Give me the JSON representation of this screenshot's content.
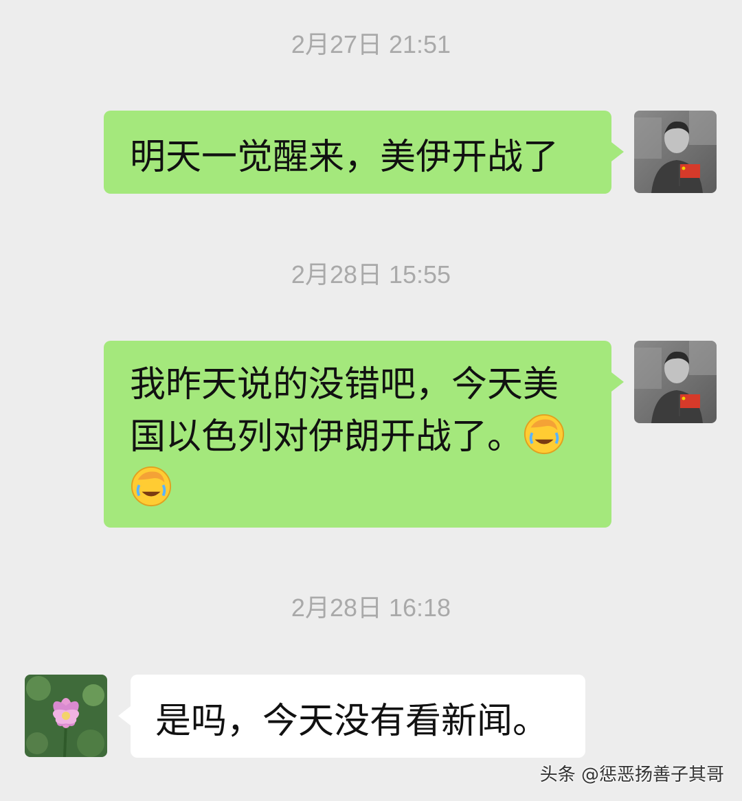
{
  "messages": [
    {
      "timestamp": "2月27日 21:51",
      "text": "明天一觉醒来，美伊开战了"
    },
    {
      "timestamp": "2月28日 15:55",
      "line1": "我昨天说的没错吧，今天美",
      "line2": "国以色列对伊朗开战了。",
      "emoji": "face-palm-crying-laughing-emoji"
    },
    {
      "timestamp": "2月28日 16:18",
      "text": "是吗，今天没有看新闻。"
    }
  ],
  "avatars": {
    "self": "grayscale-man-photo-with-red-flag-avatar",
    "other": "pink-lotus-flower-avatar"
  },
  "colors": {
    "background": "#ededed",
    "my_bubble": "#a4e87c",
    "their_bubble": "#ffffff",
    "timestamp": "#a9a9a9"
  },
  "watermark": "头条 @惩恶扬善子其哥"
}
